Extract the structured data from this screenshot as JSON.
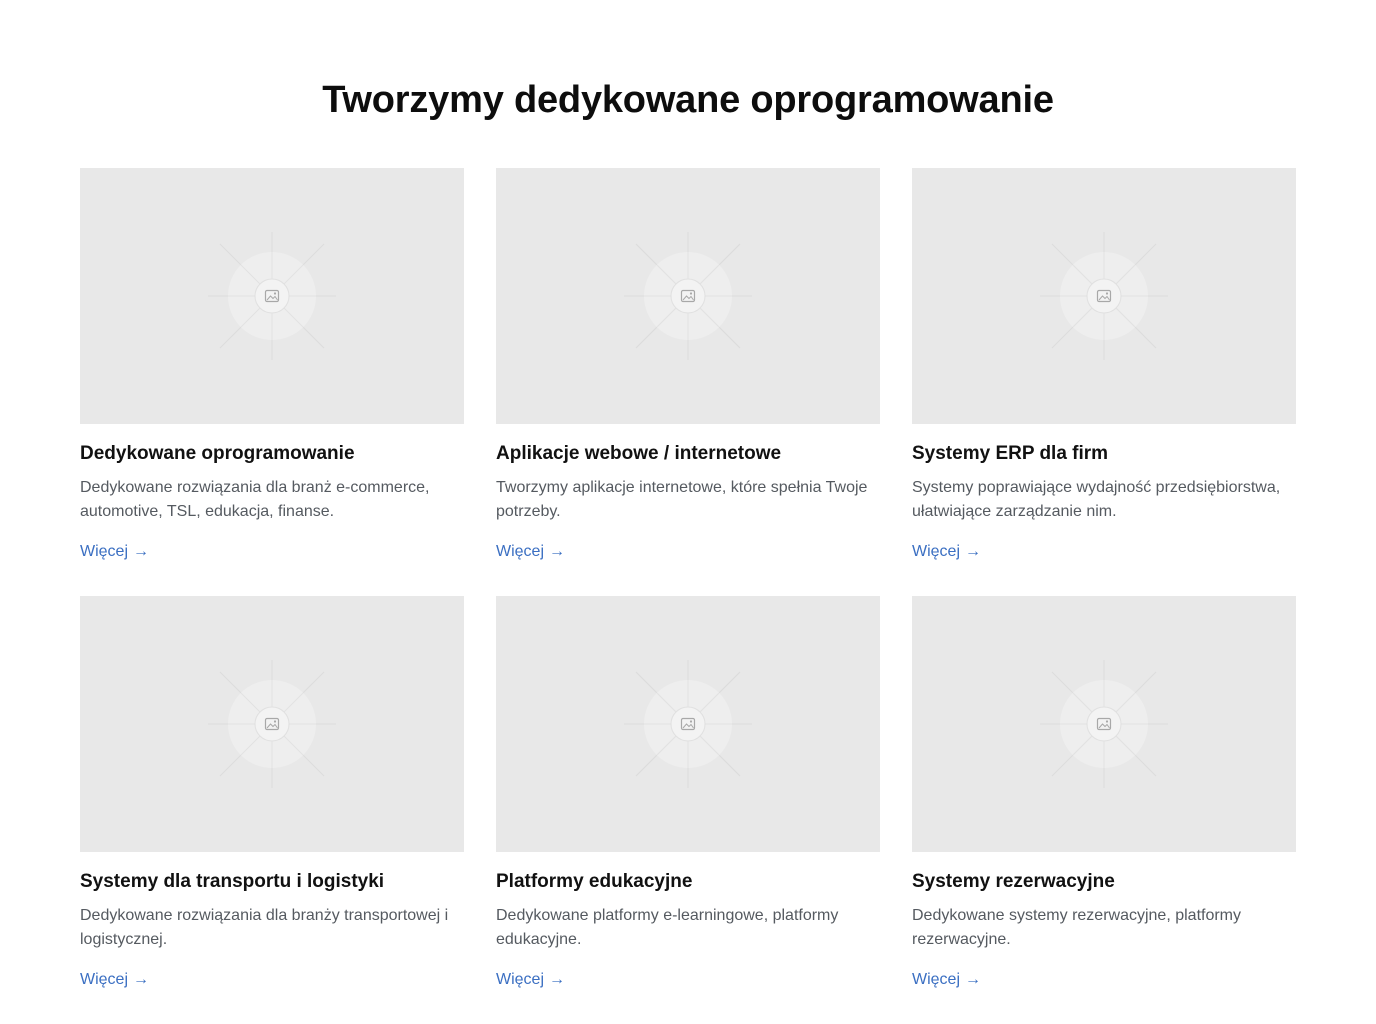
{
  "section": {
    "title": "Tworzymy dedykowane oprogramowanie"
  },
  "cards": [
    {
      "title": "Dedykowane oprogramowanie",
      "description": "Dedykowane rozwiązania dla branż e-commerce, automotive, TSL, edukacja, finanse.",
      "link_label": "Więcej",
      "link_arrow": "→",
      "image_icon": "image-placeholder-icon"
    },
    {
      "title": "Aplikacje webowe / internetowe",
      "description": "Tworzymy aplikacje internetowe, które spełnia Twoje potrzeby.",
      "link_label": "Więcej",
      "link_arrow": "→",
      "image_icon": "image-placeholder-icon"
    },
    {
      "title": "Systemy ERP dla firm",
      "description": "Systemy poprawiające wydajność przedsiębiorstwa, ułatwiające zarządzanie nim.",
      "link_label": "Więcej",
      "link_arrow": "→",
      "image_icon": "image-placeholder-icon"
    },
    {
      "title": "Systemy dla transportu i logistyki",
      "description": "Dedykowane rozwiązania dla branży transportowej i logistycznej.",
      "link_label": "Więcej",
      "link_arrow": "→",
      "image_icon": "image-placeholder-icon"
    },
    {
      "title": "Platformy edukacyjne",
      "description": "Dedykowane platformy e-learningowe, platformy edukacyjne.",
      "link_label": "Więcej",
      "link_arrow": "→",
      "image_icon": "image-placeholder-icon"
    },
    {
      "title": "Systemy rezerwacyjne",
      "description": "Dedykowane systemy rezerwacyjne, platformy rezerwacyjne.",
      "link_label": "Więcej",
      "link_arrow": "→",
      "image_icon": "image-placeholder-icon"
    }
  ],
  "colors": {
    "heading": "#0d0d0d",
    "card_title": "#111111",
    "description": "#555a60",
    "link": "#3b6fc2",
    "placeholder_bg": "#e8e8e8"
  }
}
